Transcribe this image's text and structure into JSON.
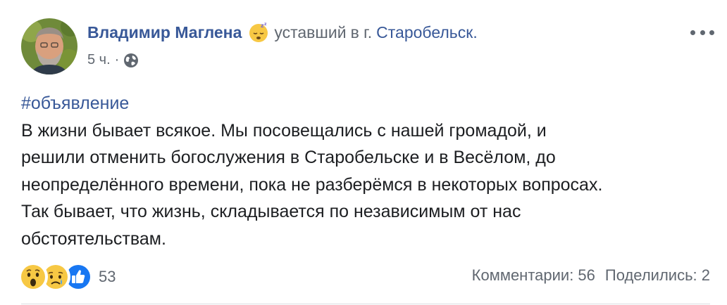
{
  "post": {
    "author": "Владимир Маглена",
    "feeling_emoji": "sleepy-face-icon",
    "feeling": "уставший",
    "location_prefix": "в г.",
    "location": "Старобельск.",
    "time": "5 ч.",
    "dot": "·",
    "privacy_icon": "globe-icon",
    "hashtag": "#объявление",
    "text_lines": [
      "В жизни бывает всякое. Мы посовещались с нашей громадой, и",
      "решили отменить богослужения в Старобельске и в Весёлом, до",
      "неопределённого времени, пока не разберёмся в некоторых вопросах.",
      "Так бывает, что жизнь, складывается по независимым от нас",
      "обстоятельствам."
    ]
  },
  "reactions": {
    "icons": [
      "wow-icon",
      "sad-icon",
      "like-icon"
    ],
    "count": "53"
  },
  "stats": {
    "comments": "Комментарии: 56",
    "shares": "Поделились: 2"
  },
  "colors": {
    "link": "#385898",
    "secondary": "#606770",
    "text": "#1c1e21",
    "like_blue": "#1877f2",
    "reaction_yellow": "#f7c844"
  }
}
